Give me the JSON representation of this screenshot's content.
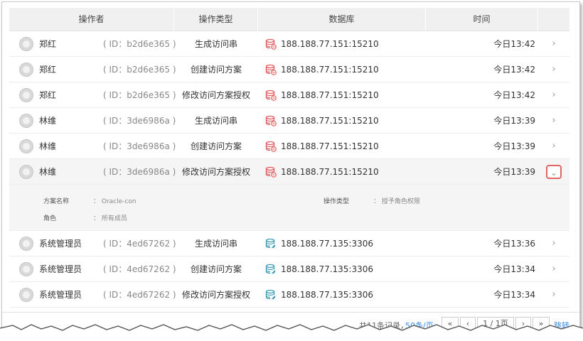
{
  "headers": {
    "operator": "操作者",
    "op_type": "操作类型",
    "database": "数据库",
    "time": "时间"
  },
  "rows": [
    {
      "name": "郑红",
      "id": "( ID：b2d6e365 )",
      "op": "生成访问串",
      "db": "188.188.77.151:15210",
      "db_icon": "database-red-icon",
      "time": "今日13:42"
    },
    {
      "name": "郑红",
      "id": "( ID：b2d6e365 )",
      "op": "创建访问方案",
      "db": "188.188.77.151:15210",
      "db_icon": "database-red-icon",
      "time": "今日13:42"
    },
    {
      "name": "郑红",
      "id": "( ID：b2d6e365 )",
      "op": "修改访问方案授权",
      "db": "188.188.77.151:15210",
      "db_icon": "database-red-icon",
      "time": "今日13:42"
    },
    {
      "name": "林维",
      "id": "( ID：3de6986a )",
      "op": "生成访问串",
      "db": "188.188.77.151:15210",
      "db_icon": "database-red-icon",
      "time": "今日13:39"
    },
    {
      "name": "林维",
      "id": "( ID：3de6986a )",
      "op": "创建访问方案",
      "db": "188.188.77.151:15210",
      "db_icon": "database-red-icon",
      "time": "今日13:39"
    },
    {
      "name": "林维",
      "id": "( ID：3de6986a )",
      "op": "修改访问方案授权",
      "db": "188.188.77.151:15210",
      "db_icon": "database-red-icon",
      "time": "今日13:39"
    },
    {
      "name": "系统管理员",
      "id": "( ID：4ed67262 )",
      "op": "生成访问串",
      "db": "188.188.77.135:3306",
      "db_icon": "database-teal-icon",
      "time": "今日13:36"
    },
    {
      "name": "系统管理员",
      "id": "( ID：4ed67262 )",
      "op": "创建访问方案",
      "db": "188.188.77.135:3306",
      "db_icon": "database-teal-icon",
      "time": "今日13:34"
    },
    {
      "name": "系统管理员",
      "id": "( ID：4ed67262 )",
      "op": "修改访问方案授权",
      "db": "188.188.77.135:3306",
      "db_icon": "database-teal-icon",
      "time": "今日13:34"
    }
  ],
  "detail": {
    "scheme_label": "方案名称",
    "scheme_value": "：  Oracle-con",
    "role_label": "角色",
    "role_value": "：  所有成员",
    "optype_label": "操作类型",
    "optype_value": "：  授予角色权限"
  },
  "pagination": {
    "total": "共11条记录，",
    "per_page": "50条/页",
    "first": "«",
    "prev": "‹",
    "current": "1 / 1页",
    "next": "›",
    "last": "»",
    "jump": "跳转"
  },
  "colors": {
    "red_db": "#e0595c",
    "teal_db": "#3a9bb3",
    "link": "#3a8ee6",
    "highlight_border": "#e06666"
  }
}
